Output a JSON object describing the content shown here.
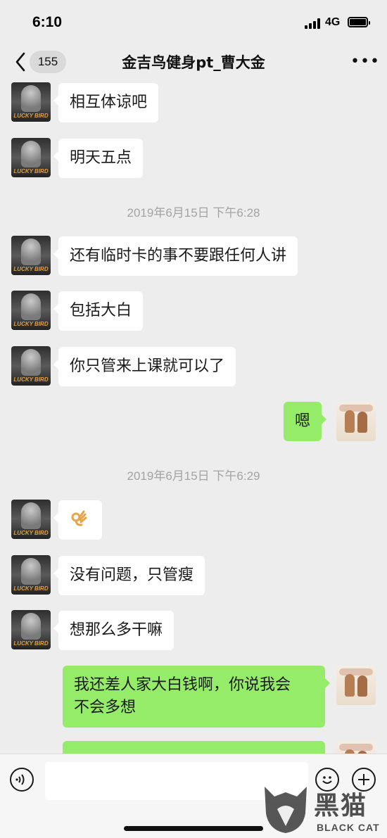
{
  "status_bar": {
    "time": "6:10",
    "network": "4G"
  },
  "nav": {
    "unread_count": "155",
    "title": "金吉鸟健身pt_曹大金",
    "more": "•••"
  },
  "avatars": {
    "contact_label": "LUCKY BIRD"
  },
  "messages": [
    {
      "side": "in",
      "text": "相互体谅吧"
    },
    {
      "side": "in",
      "text": "明天五点"
    },
    {
      "side": "time",
      "text": "2019年6月15日 下午6:28"
    },
    {
      "side": "in",
      "text": "还有临时卡的事不要跟任何人讲"
    },
    {
      "side": "in",
      "text": "包括大白"
    },
    {
      "side": "in",
      "text": "你只管来上课就可以了"
    },
    {
      "side": "out",
      "text": "嗯"
    },
    {
      "side": "time",
      "text": "2019年6月15日 下午6:29"
    },
    {
      "side": "in",
      "emoji": "ok-hand-icon"
    },
    {
      "side": "in",
      "text": "没有问题，只管瘦"
    },
    {
      "side": "in",
      "text": "想那么多干嘛"
    },
    {
      "side": "out",
      "text_line1": "我还差人家大白钱啊，你说我会",
      "text_line2": "不会多想"
    },
    {
      "side": "out",
      "text": ""
    }
  ],
  "input_bar": {
    "placeholder": ""
  },
  "watermark": {
    "text": "黑猫",
    "sub": "BLACK CAT"
  },
  "colors": {
    "background": "#ededed",
    "incoming_bubble": "#ffffff",
    "outgoing_bubble": "#95ec69",
    "timestamp": "#a3a3a3"
  }
}
